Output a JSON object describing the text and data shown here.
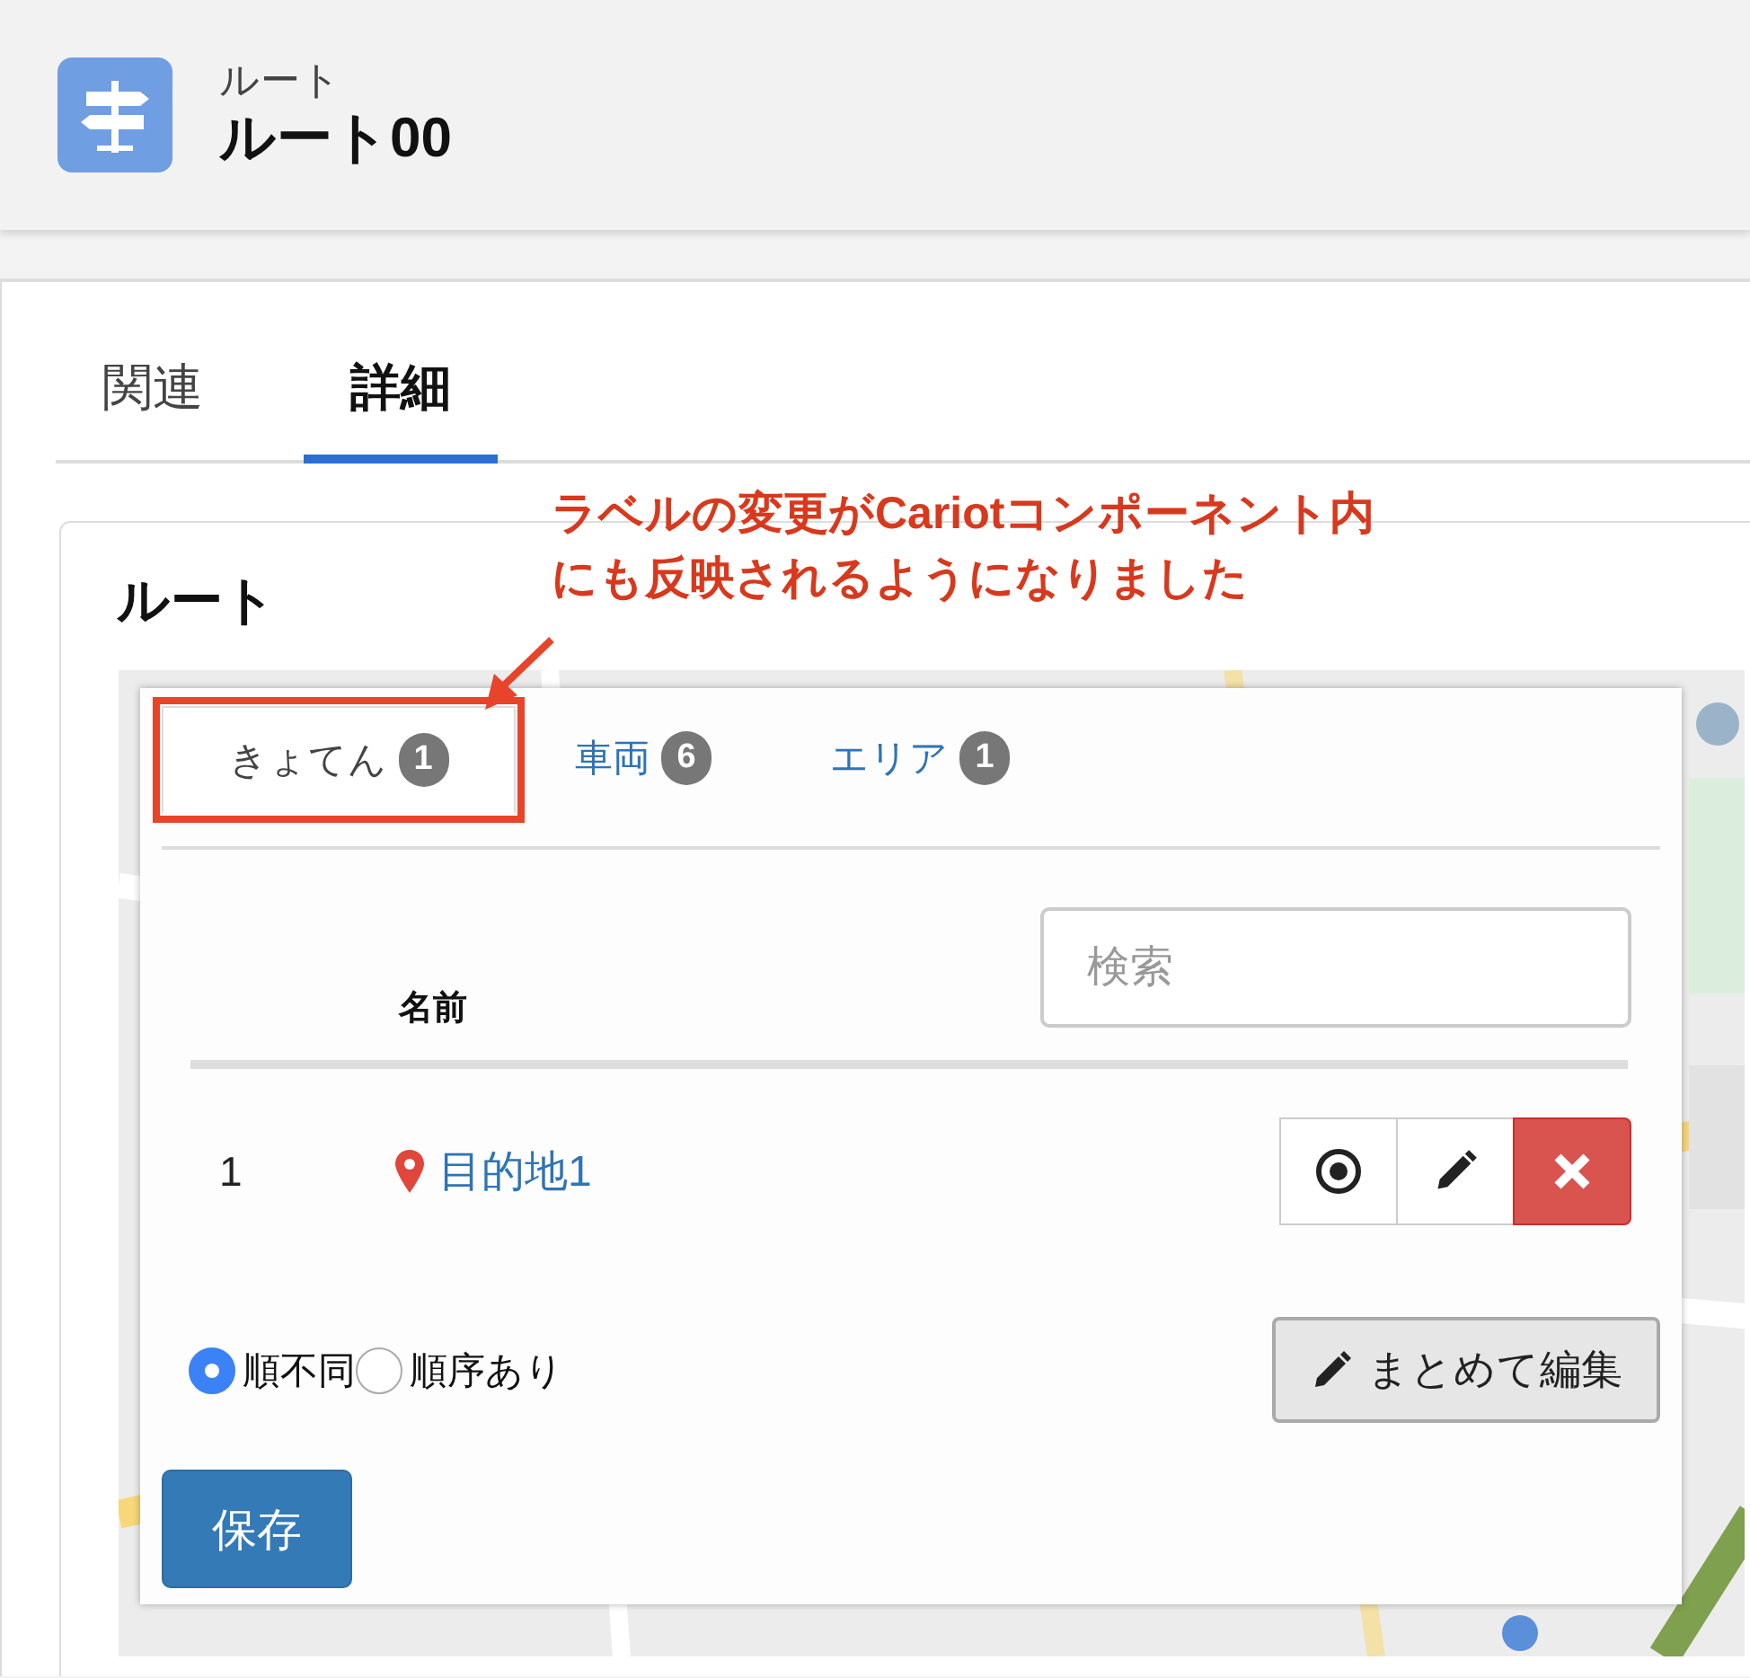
{
  "header": {
    "object_type": "ルート",
    "title": "ルート00"
  },
  "page_tabs": [
    {
      "label": "関連",
      "selected": false
    },
    {
      "label": "詳細",
      "selected": true
    }
  ],
  "annotation": {
    "lines": [
      "ラベルの変更がCariotコンポーネント内",
      "にも反映されるようになりました"
    ]
  },
  "section": {
    "title": "ルート"
  },
  "panel": {
    "tabs": [
      {
        "label": "きょてん",
        "count": "1",
        "selected": true
      },
      {
        "label": "車両",
        "count": "6",
        "selected": false
      },
      {
        "label": "エリア",
        "count": "1",
        "selected": false
      }
    ],
    "search": {
      "placeholder": "検索"
    },
    "columns": [
      "名前"
    ],
    "rows": [
      {
        "number": "1",
        "name": "目的地1"
      }
    ],
    "order_options": [
      {
        "label": "順不同",
        "selected": true
      },
      {
        "label": "順序あり",
        "selected": false
      }
    ],
    "bulk_edit_button": "まとめて編集",
    "save_button": "保存"
  }
}
